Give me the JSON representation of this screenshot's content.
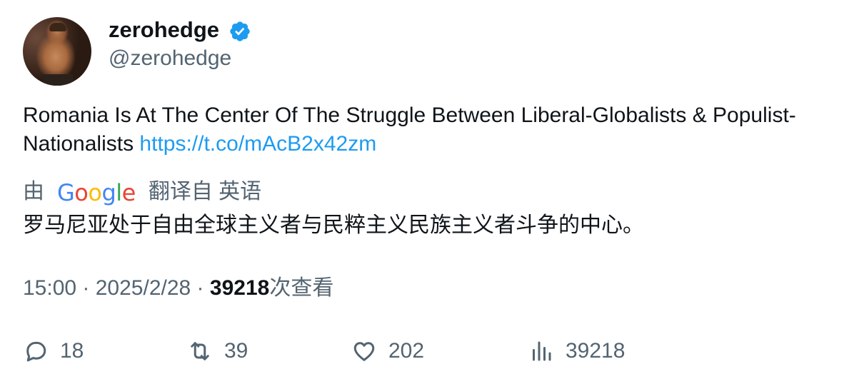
{
  "author": {
    "display_name": "zerohedge",
    "handle": "@zerohedge",
    "verified_icon": "verified-badge-icon",
    "verified_color": "#1d9bf0"
  },
  "tweet": {
    "text": "Romania Is At The Center Of The Struggle Between Liberal-Globalists & Populist-Nationalists",
    "link": "https://t.co/mAcB2x42zm"
  },
  "translation": {
    "prefix": "由",
    "provider": "Google",
    "suffix": "翻译自 英语",
    "text": "罗马尼亚处于自由全球主义者与民粹主义民族主义者斗争的中心。"
  },
  "meta": {
    "time": "15:00",
    "separator1": " · ",
    "date": "2025/2/28",
    "separator2": " · ",
    "views_count": "39218",
    "views_label": "次查看"
  },
  "actions": {
    "replies": "18",
    "retweets": "39",
    "likes": "202",
    "views": "39218"
  },
  "colors": {
    "text_primary": "#0f1419",
    "text_secondary": "#536471",
    "link": "#1d9bf0"
  }
}
